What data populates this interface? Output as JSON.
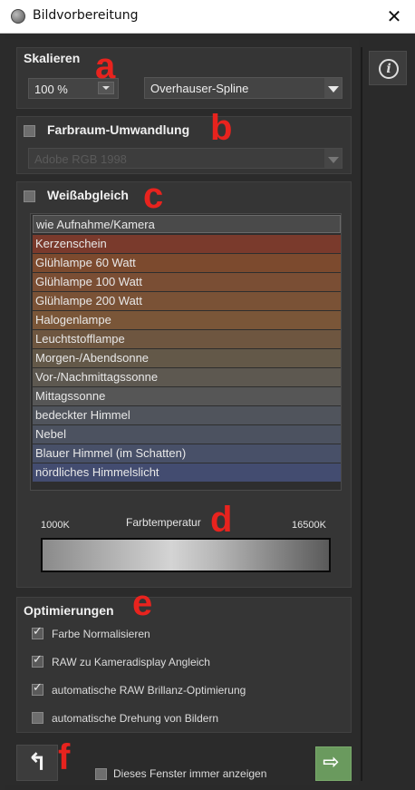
{
  "window": {
    "title": "Bildvorbereitung",
    "close": "✕"
  },
  "info": {
    "glyph": "i"
  },
  "scale": {
    "title": "Skalieren",
    "percent_value": "100 %",
    "method": "Overhauser-Spline",
    "marker": "a"
  },
  "colorspace": {
    "title": "Farbraum-Umwandlung",
    "checked": false,
    "value": "Adobe RGB 1998",
    "marker": "b"
  },
  "whitebalance": {
    "title": "Weißabgleich",
    "checked": false,
    "marker": "c",
    "items": [
      {
        "label": "wie Aufnahme/Kamera",
        "color": "#4a4a4a"
      },
      {
        "label": "Kerzenschein",
        "color": "#7a3a2c"
      },
      {
        "label": "Glühlampe 60 Watt",
        "color": "#7c4a2e"
      },
      {
        "label": "Glühlampe 100 Watt",
        "color": "#7a4e34"
      },
      {
        "label": "Glühlampe 200 Watt",
        "color": "#7a5236"
      },
      {
        "label": "Halogenlampe",
        "color": "#7a5638"
      },
      {
        "label": "Leuchtstofflampe",
        "color": "#6e5640"
      },
      {
        "label": "Morgen-/Abendsonne",
        "color": "#635848"
      },
      {
        "label": "Vor-/Nachmittagssonne",
        "color": "#5d5850"
      },
      {
        "label": "Mittagssonne",
        "color": "#565656"
      },
      {
        "label": "bedeckter Himmel",
        "color": "#50545c"
      },
      {
        "label": "Nebel",
        "color": "#4c5260"
      },
      {
        "label": "Blauer Himmel (im Schatten)",
        "color": "#485068"
      },
      {
        "label": "nördliches Himmelslicht",
        "color": "#434c70"
      }
    ]
  },
  "temperature": {
    "label": "Farbtemperatur",
    "min_label": "1000K",
    "max_label": "16500K",
    "marker": "d"
  },
  "optimizations": {
    "title": "Optimierungen",
    "marker": "e",
    "options": [
      {
        "label": "Farbe Normalisieren",
        "checked": true
      },
      {
        "label": "RAW zu Kameradisplay Angleich",
        "checked": true
      },
      {
        "label": "automatische RAW Brillanz-Optimierung",
        "checked": true
      },
      {
        "label": "automatische Drehung von Bildern",
        "checked": false
      }
    ]
  },
  "footer": {
    "undo_glyph": "↰",
    "marker": "f",
    "always_show_label": "Dieses Fenster immer anzeigen",
    "always_show_checked": false,
    "next_glyph": "⇨"
  },
  "colors": {
    "accent_green": "#6a9a5e",
    "marker_red": "#e8231e",
    "panel": "#353535"
  }
}
